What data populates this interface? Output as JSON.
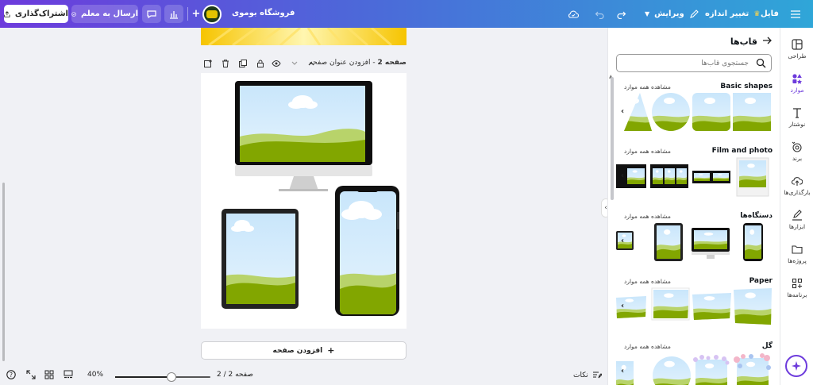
{
  "topbar": {
    "share_label": "اشتراک‌گذاری",
    "send_label": "ارسال به معلم",
    "store_name": "فروشگاه بوموی",
    "edit_label": "ویرایش",
    "resize_label": "تغییر اندازه",
    "file_label": "فایل"
  },
  "rail": {
    "items": [
      {
        "label": "طراحی",
        "icon": "layout-icon"
      },
      {
        "label": "موارد",
        "icon": "elements-icon"
      },
      {
        "label": "نوشتار",
        "icon": "text-icon"
      },
      {
        "label": "برند",
        "icon": "brand-icon"
      },
      {
        "label": "بارگذاری‌ها",
        "icon": "upload-icon"
      },
      {
        "label": "ابزارها",
        "icon": "draw-icon"
      },
      {
        "label": "پروژه‌ها",
        "icon": "folder-icon"
      },
      {
        "label": "برنامه‌ها",
        "icon": "apps-icon"
      }
    ],
    "active_index": 1
  },
  "panel": {
    "title": "قاب‌ها",
    "search_placeholder": "جستجوی قاب‌ها",
    "see_all": "مشاهده همه موارد",
    "sections": [
      {
        "title": "Basic shapes"
      },
      {
        "title": "Film and photo"
      },
      {
        "title": "دستگاه‌ها"
      },
      {
        "title": "Paper"
      },
      {
        "title": "گل"
      }
    ]
  },
  "canvas": {
    "page_label": "صفحه 2",
    "page_title_placeholder": "افزودن عنوان صفحه",
    "add_page_label": "افزودن صفحه"
  },
  "bottombar": {
    "notes_label": "نکات",
    "page_counter": "صفحه 2 / 2",
    "zoom": "40%",
    "zoom_value": 0.6
  },
  "colors": {
    "brand_purple": "#6d3bdc",
    "sky": "#cfe8fb",
    "grass": "#82a600",
    "grass_light": "#b8d36a"
  }
}
